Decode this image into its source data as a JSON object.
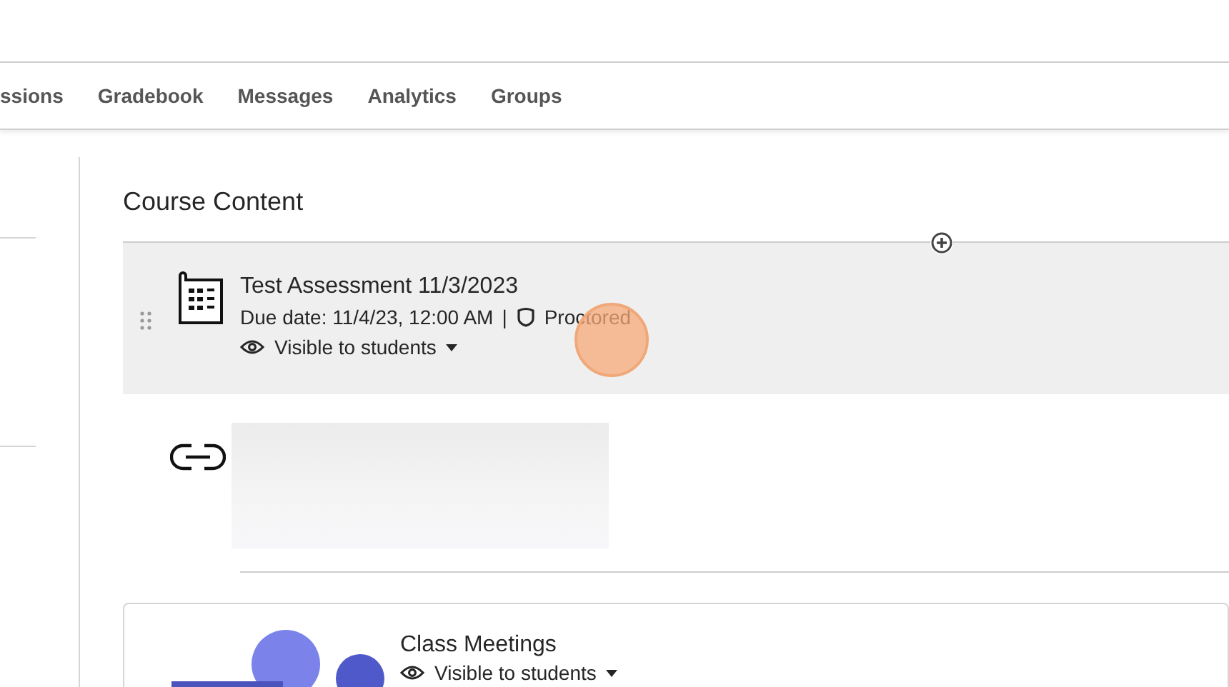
{
  "nav_tabs": [
    {
      "label": "ssions"
    },
    {
      "label": "Gradebook"
    },
    {
      "label": "Messages"
    },
    {
      "label": "Analytics"
    },
    {
      "label": "Groups"
    }
  ],
  "content": {
    "title": "Course Content"
  },
  "items": [
    {
      "kind": "assessment",
      "highlighted": true,
      "title": "Test Assessment 11/3/2023",
      "due": "Due date: 11/4/23, 12:00 AM",
      "separator": "|",
      "badge": "Proctored",
      "visibility": "Visible to students"
    },
    {
      "kind": "link",
      "highlighted": false
    },
    {
      "kind": "meeting",
      "highlighted": false,
      "title": "Class Meetings",
      "visibility": "Visible to students"
    }
  ]
}
